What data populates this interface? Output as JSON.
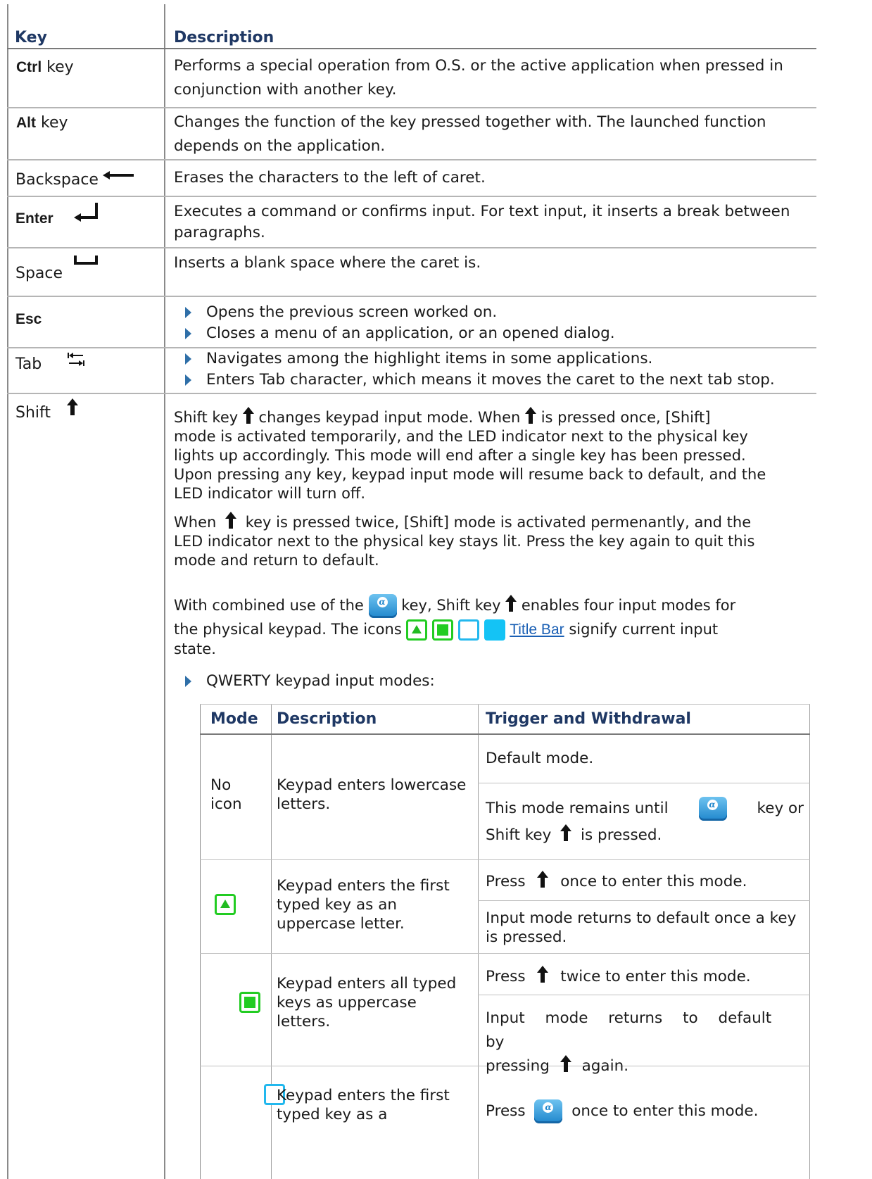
{
  "header": {
    "key": "Key",
    "description": "Description"
  },
  "rows": [
    {
      "key_bold": "Ctrl",
      "key_rest": " key",
      "desc": [
        "Performs a special operation from O.S. or the active application when pressed in",
        "conjunction with another key."
      ]
    },
    {
      "key_bold": "Alt",
      "key_rest": " key",
      "desc": [
        "Changes the function of the key pressed together with. The launched function",
        "depends on the application."
      ]
    },
    {
      "key": "Backspace",
      "key_icon": "left-arrow-icon",
      "desc": [
        "Erases the characters to the left of caret."
      ]
    },
    {
      "key_bold": "Enter",
      "key_icon": "return-arrow-icon",
      "desc": [
        "Executes a command or confirms input. For text input, it inserts a break between",
        "paragraphs."
      ]
    },
    {
      "key": "Space",
      "key_icon": "space-bar-icon",
      "desc": [
        "Inserts a blank space where the caret is."
      ]
    },
    {
      "key_bold": "Esc",
      "bullets": [
        "Opens the previous screen worked on.",
        "Closes a menu of an application, or an opened dialog."
      ]
    },
    {
      "key": "Tab",
      "key_icon": "tab-arrows-icon",
      "bullets": [
        "Navigates among the highlight items in some applications.",
        "Enters Tab character, which means it moves the caret to the next tab stop."
      ]
    },
    {
      "key": "Shift",
      "key_icon": "up-arrow-icon"
    }
  ],
  "shift": {
    "p1": {
      "l1a": "Shift key",
      "l1b": "changes keypad input mode. When",
      "l1c": "is pressed once, [Shift]",
      "l2": "mode is activated temporarily, and the LED indicator next to the physical key",
      "l3": "lights up accordingly. This mode will end after a single key has been pressed.",
      "l4": "Upon pressing any key, keypad input mode will resume back to default, and the",
      "l5": "LED indicator will turn off."
    },
    "p2": {
      "l1a": "When",
      "l1b": "key is pressed twice, [Shift] mode is activated permenantly, and the",
      "l2": "LED indicator next to the physical key stays lit. Press the key again to quit this",
      "l3": "mode and return to default."
    },
    "p3": {
      "l1a": "With combined use of the",
      "l1b": "key, Shift key",
      "l1c": "enables four input modes for",
      "l2a": "the physical keypad. The icons",
      "l2_link": "Title Bar",
      "l2b": "signify current input",
      "l3": "state."
    },
    "bullet": "QWERTY keypad input modes:"
  },
  "subtable": {
    "headers": [
      "Mode",
      "Description",
      "Trigger and Withdrawal"
    ],
    "rows": [
      {
        "mode": "No icon",
        "description": "Keypad enters lowercase letters.",
        "t1": "Default mode.",
        "t2a": "This mode remains until",
        "t2b": "key or",
        "t2c": "Shift key",
        "t2d": "is pressed."
      },
      {
        "mode_icon": "triangle-mode-icon",
        "description": "Keypad enters the first typed key as an uppercase letter.",
        "t1a": "Press",
        "t1b": "once to enter this mode.",
        "t2": "Input mode returns to default once a key is pressed."
      },
      {
        "mode_icon": "square-mode-icon",
        "description": "Keypad enters all typed keys as uppercase letters.",
        "t1a": "Press",
        "t1b": "twice to enter this mode.",
        "t2a": "Input mode returns to default by",
        "t2b": "pressing",
        "t2c": "again."
      },
      {
        "mode_icon": "outline-mode-icon",
        "description": "Keypad enters the first typed key as a",
        "t1a": "Press",
        "t1b": "once to enter this mode."
      }
    ]
  },
  "colors": {
    "header": "#1f3864",
    "bullet": "#2f6fa8",
    "green_icon": "#22cc22",
    "blue_icon": "#14c3f5",
    "link": "#1a5fb4"
  }
}
